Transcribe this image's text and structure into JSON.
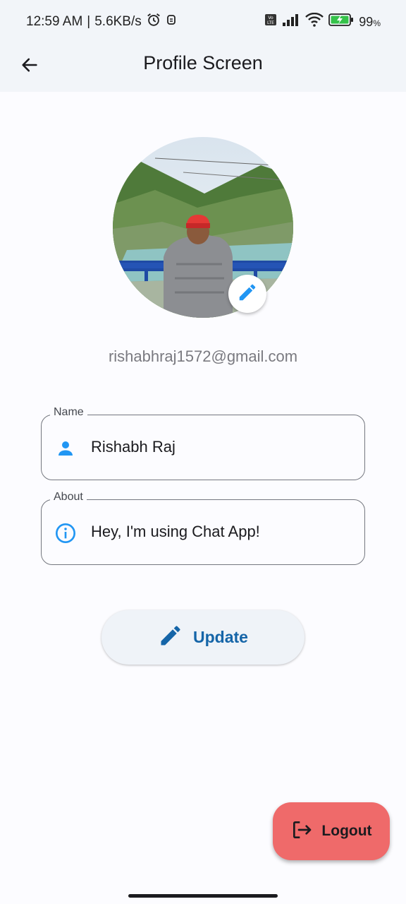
{
  "status_bar": {
    "time": "12:59 AM",
    "separator": "|",
    "net_speed": "5.6KB/s",
    "battery_percent": "99",
    "battery_unit": "%",
    "icons": [
      "alarm-icon",
      "notification-icon",
      "volte-icon",
      "signal-icon",
      "wifi-icon",
      "battery-charging-icon"
    ]
  },
  "app_bar": {
    "title": "Profile Screen",
    "back_icon": "arrow-back-icon"
  },
  "profile": {
    "email": "rishabhraj1572@gmail.com",
    "edit_icon": "pencil-icon"
  },
  "fields": {
    "name": {
      "label": "Name",
      "value": "Rishabh Raj",
      "icon": "person-icon"
    },
    "about": {
      "label": "About",
      "value": "Hey, I'm using Chat App!",
      "icon": "info-icon"
    }
  },
  "actions": {
    "update_label": "Update",
    "logout_label": "Logout"
  },
  "colors": {
    "accent": "#2196f3",
    "update_text": "#1565a8",
    "logout_bg": "#ef6a6a",
    "appbar_bg": "#f2f5f9"
  }
}
